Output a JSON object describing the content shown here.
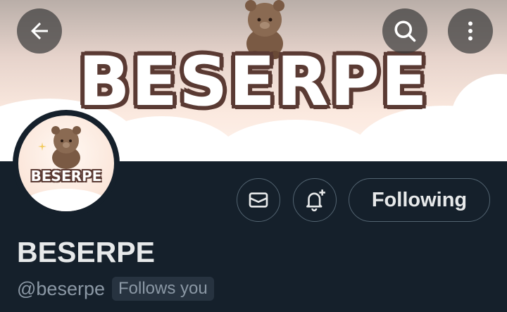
{
  "banner": {
    "title": "BESERPE"
  },
  "avatar": {
    "text": "BESERPE"
  },
  "header": {
    "back_icon": "arrow-left-icon",
    "search_icon": "search-icon",
    "more_icon": "more-vertical-icon"
  },
  "actions": {
    "message_icon": "mail-icon",
    "notify_icon": "bell-plus-icon",
    "following_label": "Following"
  },
  "profile": {
    "display_name": "BESERPE",
    "handle": "@beserpe",
    "follows_you": "Follows you"
  },
  "colors": {
    "background": "#15202b",
    "text_primary": "#e7e9ea",
    "text_secondary": "#8b98a5",
    "border": "#536471",
    "banner_outline": "#5a3a33"
  }
}
